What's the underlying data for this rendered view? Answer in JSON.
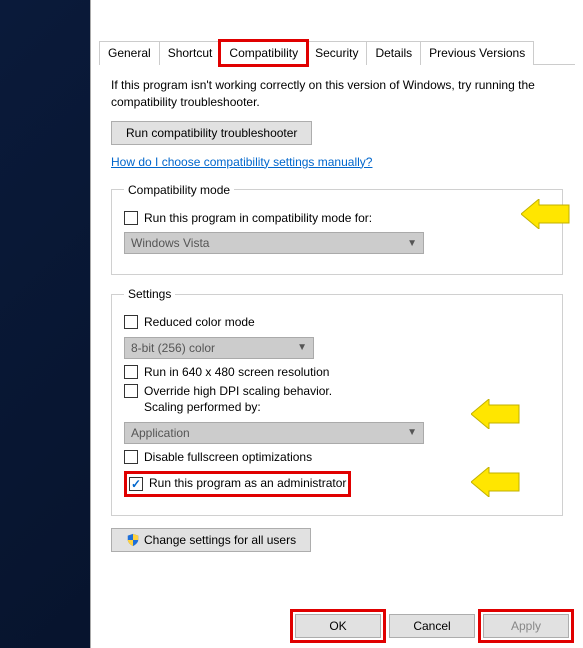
{
  "tabs": {
    "general": "General",
    "shortcut": "Shortcut",
    "compatibility": "Compatibility",
    "security": "Security",
    "details": "Details",
    "previous": "Previous Versions"
  },
  "intro": "If this program isn't working correctly on this version of Windows, try running the compatibility troubleshooter.",
  "troubleshoot_btn": "Run compatibility troubleshooter",
  "help_link": "How do I choose compatibility settings manually?",
  "compat_mode": {
    "legend": "Compatibility mode",
    "run_label": "Run this program in compatibility mode for:",
    "select_value": "Windows Vista"
  },
  "settings": {
    "legend": "Settings",
    "reduced_color": "Reduced color mode",
    "color_value": "8-bit (256) color",
    "run_640": "Run in 640 x 480 screen resolution",
    "override_dpi": "Override high DPI scaling behavior.\nScaling performed by:",
    "dpi_value": "Application",
    "disable_fullscreen": "Disable fullscreen optimizations",
    "run_admin": "Run this program as an administrator"
  },
  "change_all_users": "Change settings for all users",
  "buttons": {
    "ok": "OK",
    "cancel": "Cancel",
    "apply": "Apply"
  }
}
